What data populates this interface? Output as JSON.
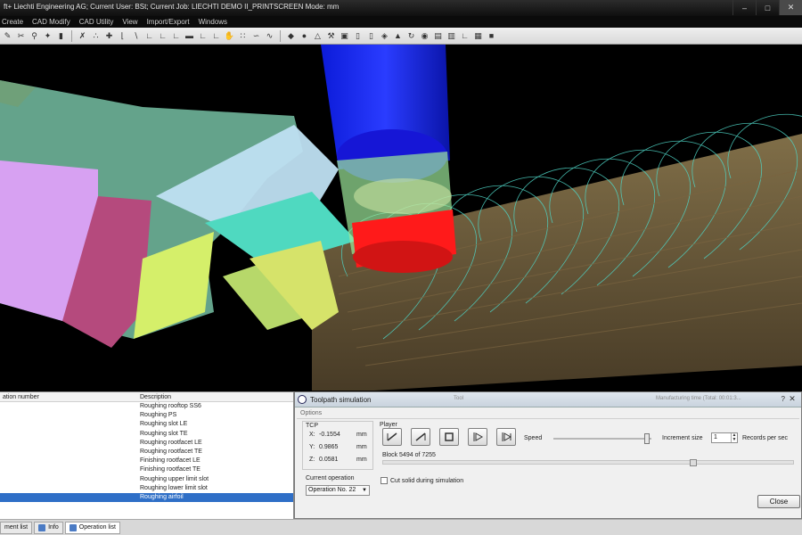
{
  "window": {
    "title": "ft+ Liechti Engineering AG; Current User: BSt; Current Job: LIECHTI DEMO II_PRINTSCREEN Mode: mm"
  },
  "menu": [
    "Create",
    "CAD Modify",
    "CAD Utility",
    "View",
    "Import/Export",
    "Windows"
  ],
  "operation_list": {
    "columns": [
      "ation number",
      "Description"
    ],
    "rows": [
      "Roughing rooftop SS6",
      "Roughing PS",
      "Roughing slot LE",
      "Roughing slot TE",
      "Roughing rootfacet LE",
      "Roughing rootfacet TE",
      "Finishing rootfacet LE",
      "Finishing rootfacet TE",
      "Roughing upper limit slot",
      "Roughing lower limit slot",
      "Roughing airfoil"
    ],
    "selected_index": 10
  },
  "bottom_tabs": [
    "ment list",
    "Info",
    "Operation list"
  ],
  "dialog": {
    "title": "Toolpath simulation",
    "faint_title_1": "Tool",
    "faint_title_2": "Manufacturing time (Total: 00:01:3...",
    "help": "?",
    "options_label": "Options",
    "tcp_label": "TCP",
    "coords": [
      {
        "axis": "X:",
        "value": "-0.1554",
        "unit": "mm"
      },
      {
        "axis": "Y:",
        "value": "0.9865",
        "unit": "mm"
      },
      {
        "axis": "Z:",
        "value": "0.0581",
        "unit": "mm"
      }
    ],
    "player_label": "Player",
    "speed_label": "Speed",
    "speed_level": 0.95,
    "increment_label": "Increment size",
    "increment_value": "1",
    "records_label": "Records per sec",
    "block_text": "Block 5494 of 7255",
    "block_progress": 0.757,
    "current_op_label": "Current operation",
    "current_op_value": "Operation No. 22",
    "cut_solid_label": "Cut solid during simulation",
    "close_label": "Close"
  }
}
